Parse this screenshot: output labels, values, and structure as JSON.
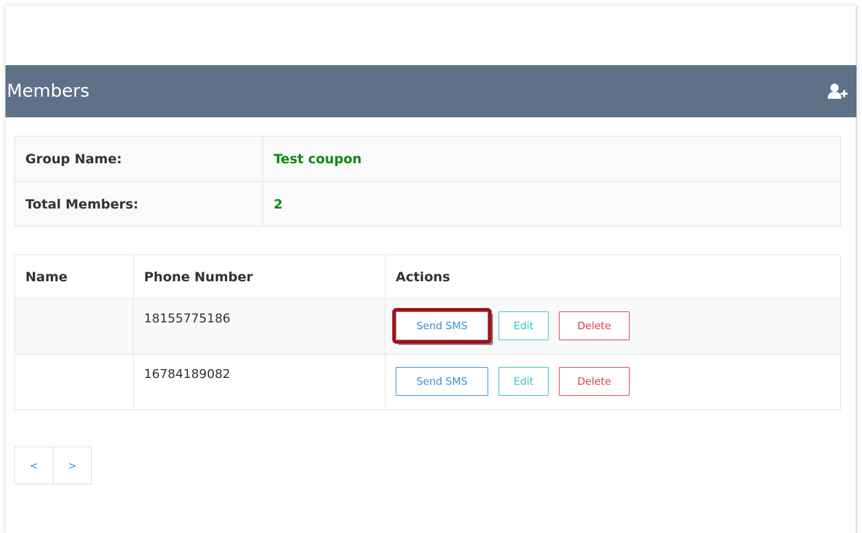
{
  "header": {
    "title": "Members",
    "add_icon": "add-user-icon"
  },
  "group_info": {
    "group_name_label": "Group Name:",
    "group_name_value": "Test coupon",
    "total_members_label": "Total Members:",
    "total_members_value": "2"
  },
  "members_table": {
    "headers": {
      "name": "Name",
      "phone": "Phone Number",
      "actions": "Actions"
    },
    "rows": [
      {
        "name": "",
        "phone": "18155775186",
        "send_sms": "Send SMS",
        "edit": "Edit",
        "delete": "Delete"
      },
      {
        "name": "",
        "phone": "16784189082",
        "send_sms": "Send SMS",
        "edit": "Edit",
        "delete": "Delete"
      }
    ]
  },
  "pagination": {
    "prev": "<",
    "next": ">"
  },
  "colors": {
    "header_bg": "#5f7189",
    "value_green": "#0b8a10",
    "sms_blue": "#3b8fd9",
    "edit_teal": "#35c6c6",
    "delete_red": "#e0414f",
    "highlight_red": "#a3101a"
  }
}
